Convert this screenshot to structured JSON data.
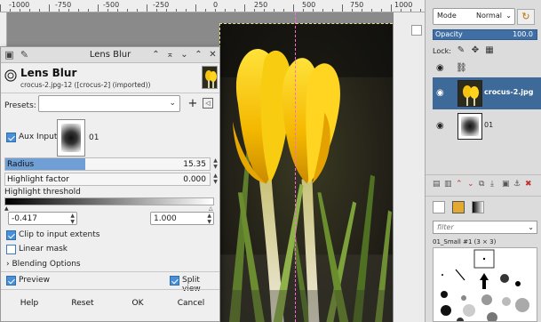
{
  "ruler": {
    "labels": [
      "-1000",
      "-750",
      "-500",
      "-250",
      "0",
      "250",
      "500",
      "750",
      "1000"
    ]
  },
  "dialog": {
    "title": "Lens Blur",
    "filter_name": "Lens Blur",
    "filter_sub": "crocus-2.jpg-12 ([crocus-2] (imported))",
    "presets_label": "Presets:",
    "presets_value": "",
    "aux_label": "Aux Input",
    "aux_checked": true,
    "aux_value": "01",
    "radius": {
      "label": "Radius",
      "value": "15.35",
      "fill_fraction": 0.39
    },
    "highlight_factor": {
      "label": "Highlight factor",
      "value": "0.000",
      "fill_fraction": 0
    },
    "highlight_threshold": {
      "label": "Highlight threshold",
      "low": "-0.417",
      "high": "1.000"
    },
    "clip_label": "Clip to input extents",
    "clip_checked": true,
    "linear_mask_label": "Linear mask",
    "linear_mask_checked": false,
    "blending_label": "Blending Options",
    "preview_label": "Preview",
    "preview_checked": true,
    "split_label": "Split view",
    "split_checked": true,
    "buttons": {
      "help": "Help",
      "reset": "Reset",
      "ok": "OK",
      "cancel": "Cancel"
    }
  },
  "dock": {
    "mode_label": "Mode",
    "mode_value": "Normal",
    "opacity_label": "Opacity",
    "opacity_value": "100.0",
    "lock_label": "Lock:",
    "layers": [
      {
        "name": "crocus-2.jpg",
        "selected": true
      },
      {
        "name": "01",
        "selected": false
      }
    ],
    "brush_filter_placeholder": "filter",
    "brush_name": "01_Small #1 (3 × 3)"
  },
  "colors": {
    "accent": "#4a90d9",
    "selection": "#3d6a99",
    "slider_fill": "#6f9fd4"
  }
}
